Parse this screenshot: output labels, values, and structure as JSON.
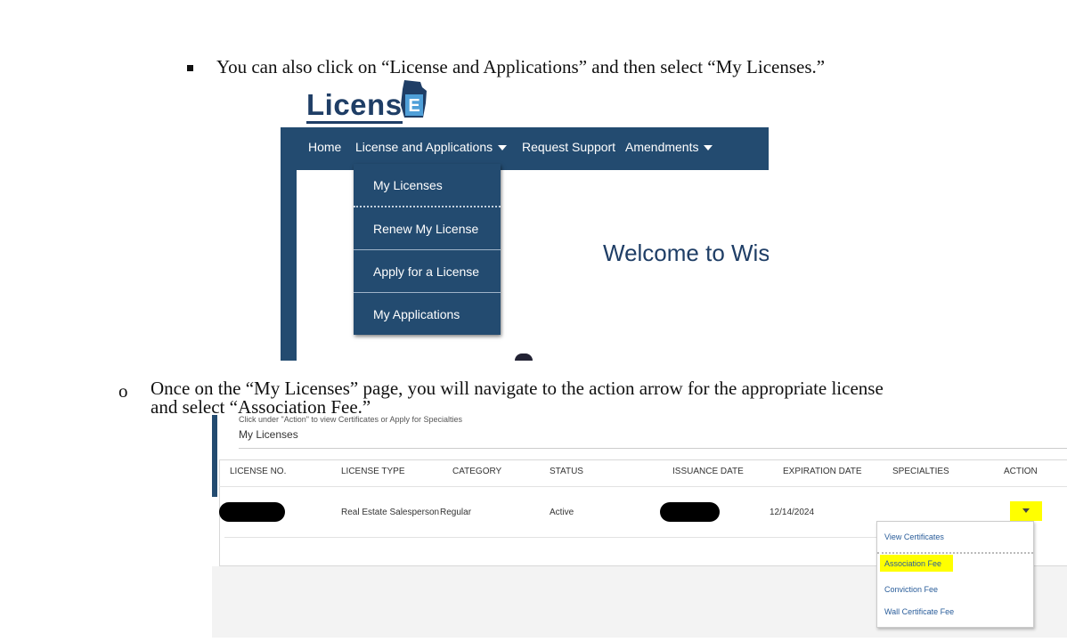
{
  "instructions": {
    "line1": "You can also click on “License and Applications” and then select “My Licenses.”",
    "line2a": "Once on the “My Licenses” page, you will navigate to the action arrow for the appropriate license",
    "line2b": "and select “Association Fee.”"
  },
  "screenshot1": {
    "logo_text": "Licens",
    "logo_badge": "E",
    "nav": {
      "home": "Home",
      "license_apps": "License and Applications",
      "request_support": "Request Support",
      "amendments": "Amendments"
    },
    "dropdown": [
      "My Licenses",
      "Renew My License",
      "Apply for a License",
      "My Applications"
    ],
    "welcome": "Welcome to Wis"
  },
  "screenshot2": {
    "hint": "Click under \"Action\" to view Certificates or Apply for Specialties",
    "title": "My Licenses",
    "columns": [
      "LICENSE NO.",
      "LICENSE TYPE",
      "CATEGORY",
      "STATUS",
      "ISSUANCE DATE",
      "EXPIRATION DATE",
      "SPECIALTIES",
      "ACTION"
    ],
    "row": {
      "license_type": "Real Estate Salesperson",
      "category": "Regular",
      "status": "Active",
      "expiration_date": "12/14/2024"
    },
    "action_menu": [
      "View Certificates",
      "Association Fee",
      "Conviction Fee",
      "Wall Certificate Fee"
    ]
  },
  "colors": {
    "navy": "#234b70",
    "highlight": "#ffff00",
    "link": "#2a5d9a"
  }
}
